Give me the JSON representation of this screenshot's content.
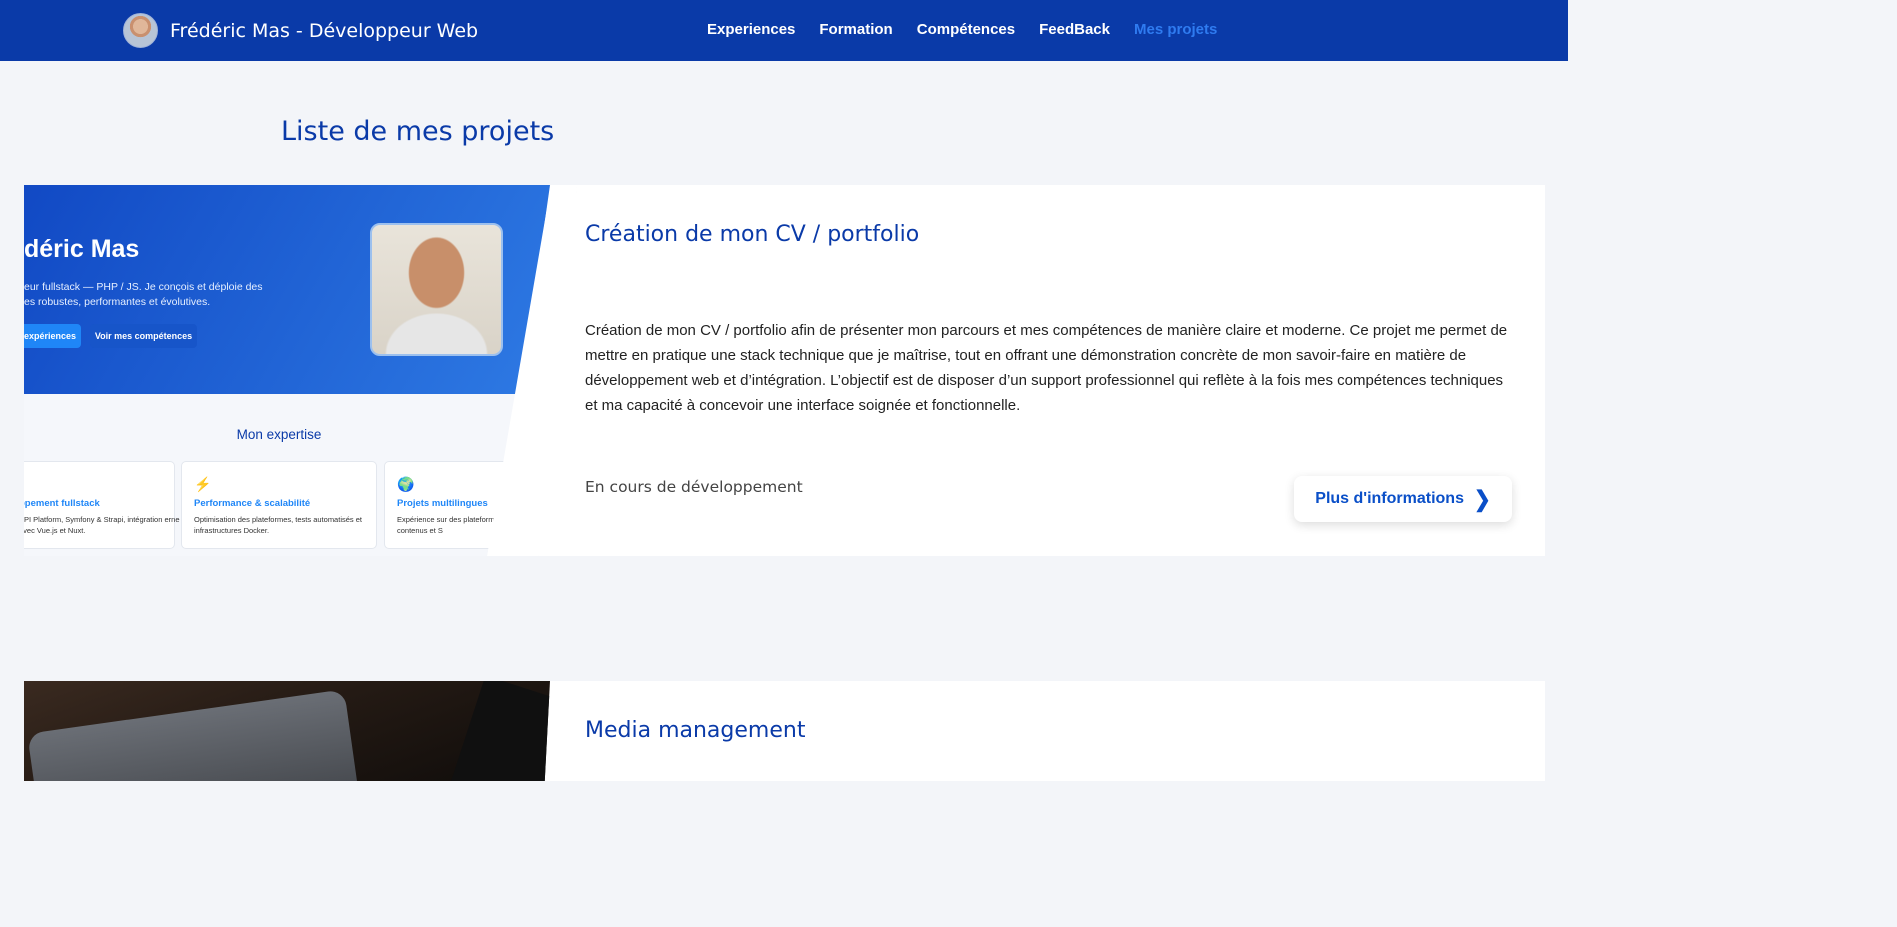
{
  "header": {
    "title": "Frédéric Mas - Développeur Web",
    "nav": [
      "Experiences",
      "Formation",
      "Compétences",
      "FeedBack",
      "Mes projets"
    ],
    "active_nav": "Mes projets",
    "colors": {
      "header_bg": "#0a3aa8",
      "active_link": "#2f7bf0"
    }
  },
  "page": {
    "heading": "Liste de mes projets"
  },
  "projects": [
    {
      "title": "Création de mon CV / portfolio",
      "description": "Création de mon CV / portfolio afin de présenter mon parcours et mes compétences de manière claire et moderne. Ce projet me permet de mettre en pratique une stack technique que je maîtrise, tout en offrant une démonstration concrète de mon savoir-faire en matière de développement web et d’intégration. L’objectif est de disposer d’un support professionnel qui reflète à la fois mes compétences techniques et ma capacité à concevoir une interface soignée et fonctionnelle.",
      "status": "En cours de développement",
      "cta": "Plus d'informations",
      "thumbnail": {
        "name": "déric Mas",
        "description": "eur fullstack — PHP / JS. Je conçois et déploie des es robustes, performantes et évolutives.",
        "button1": "expériences",
        "button2": "Voir mes compétences",
        "expertise_title": "Mon expertise",
        "tiles": [
          {
            "icon": "code-icon",
            "title": "ppement fullstack",
            "text": "API Platform, Symfony & Strapi, intégration erne avec Vue.js et Nuxt."
          },
          {
            "icon": "lightning-icon",
            "glyph": "⚡",
            "title": "Performance & scalabilité",
            "text": "Optimisation des plateformes, tests automatisés et infrastructures Docker."
          },
          {
            "icon": "globe-icon",
            "glyph": "🌍",
            "title": "Projets multilingues",
            "text": "Expérience sur des plateform gestion fine des contenus et S"
          }
        ]
      }
    },
    {
      "title": "Media management"
    }
  ]
}
